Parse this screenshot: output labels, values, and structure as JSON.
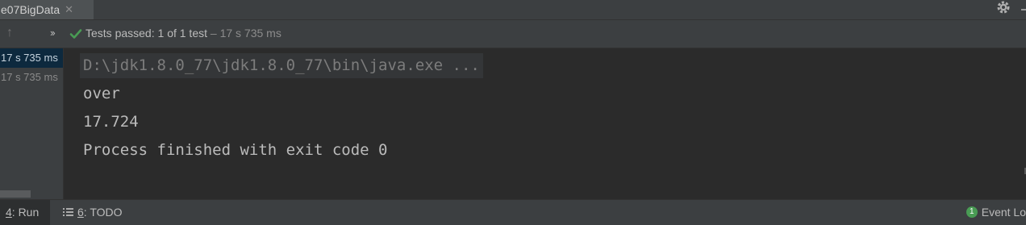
{
  "tab": {
    "title": "e07BigData",
    "close": "✕"
  },
  "toolbar": {
    "status_label": "Tests passed:",
    "count": "1",
    "of_text": "of 1 test",
    "duration": "– 17 s 735 ms"
  },
  "tree": {
    "items": [
      {
        "label": "17 s 735 ms"
      },
      {
        "label": "17 s 735 ms"
      }
    ]
  },
  "console": {
    "command": "D:\\jdk1.8.0_77\\jdk1.8.0_77\\bin\\java.exe ...",
    "lines": [
      "over",
      "17.724",
      "Process finished with exit code 0"
    ]
  },
  "bottom": {
    "run_num": "4",
    "run_label": ": Run",
    "todo_num": "6",
    "todo_label": ": TODO",
    "event_badge": "1",
    "event_label": "Event Lo"
  },
  "colors": {
    "pass_green": "#499c54",
    "selection": "#0d293e",
    "background": "#2b2b2b"
  }
}
